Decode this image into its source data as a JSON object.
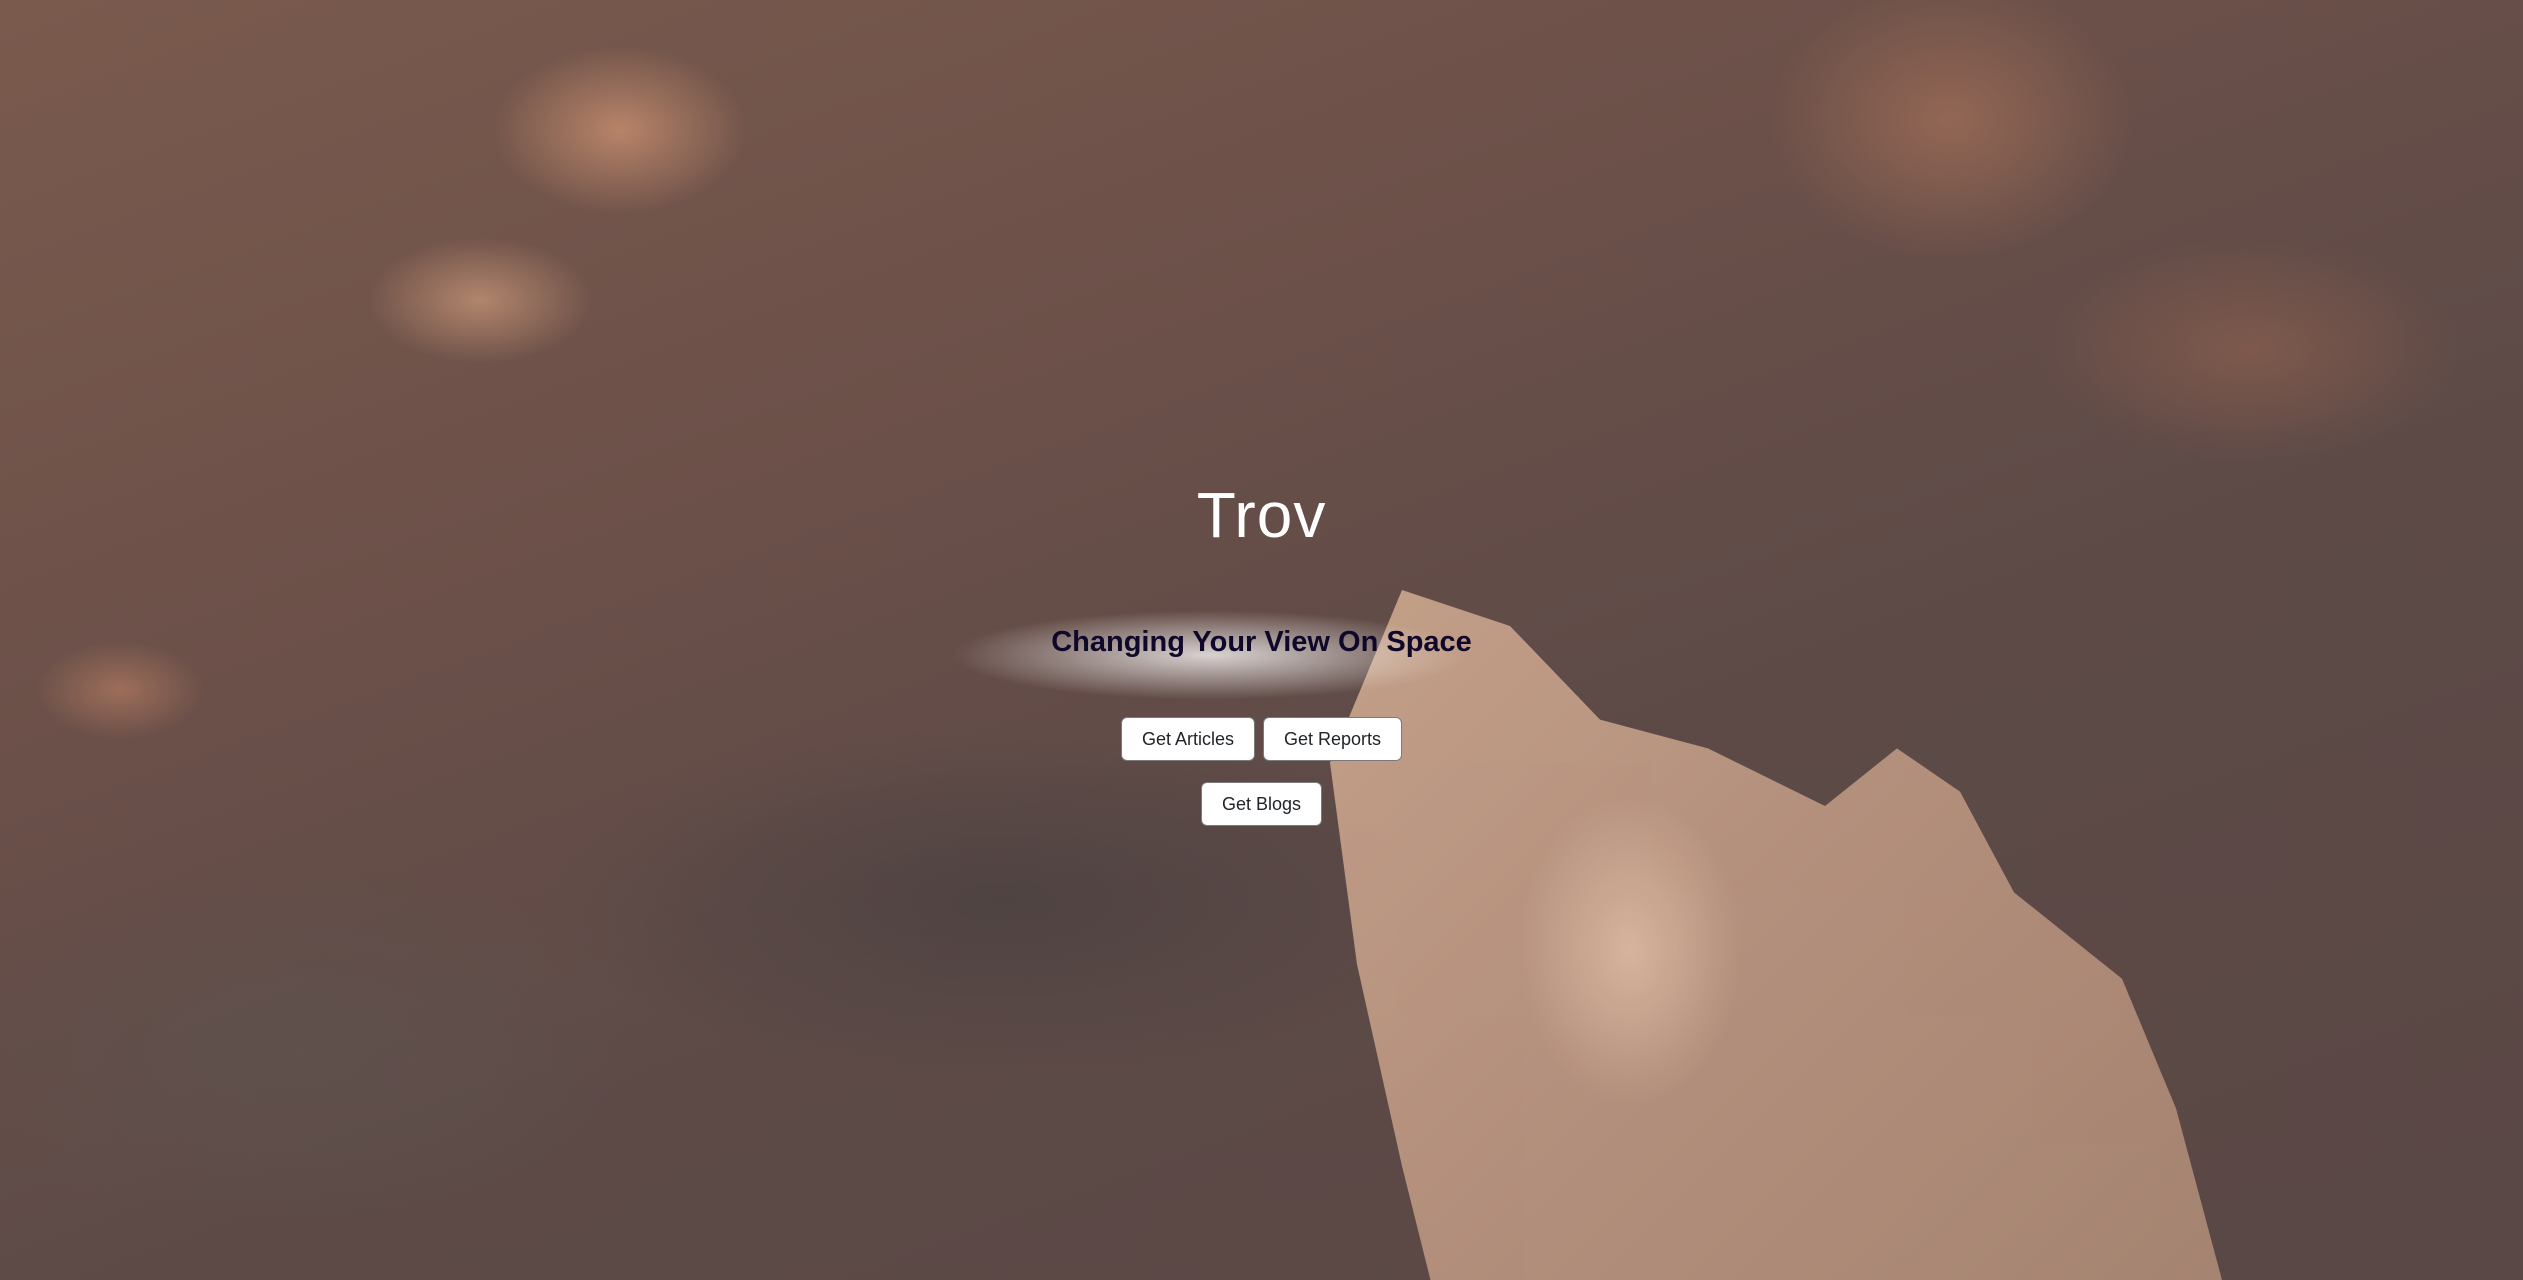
{
  "hero": {
    "title": "Trov",
    "subtitle": "Changing Your View On Space"
  },
  "buttons": {
    "articles": "Get Articles",
    "reports": "Get Reports",
    "blogs": "Get Blogs"
  }
}
